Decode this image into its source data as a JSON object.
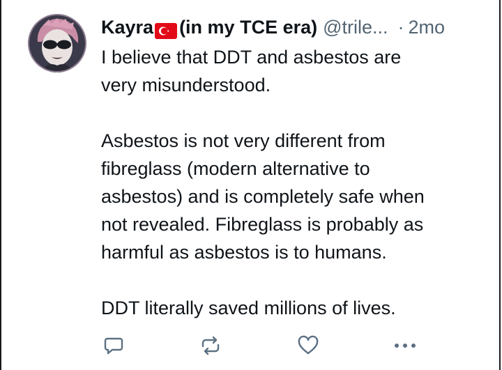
{
  "tweet": {
    "display_name": "Kayra",
    "name_suffix": "(in my TCE era)",
    "handle": "@trile...",
    "separator": "·",
    "time": "2mo",
    "paragraphs": [
      [
        "I believe that DDT and asbestos are",
        "very misunderstood."
      ],
      [
        "Asbestos is not very different from",
        "fibreglass (modern alternative to",
        "asbestos) and is completely safe when",
        "not revealed. Fibreglass is probably as",
        "harmful as asbestos is to humans."
      ],
      [
        "DDT literally saved millions of lives."
      ]
    ]
  },
  "icons": {
    "flag": "turkey-flag-icon",
    "reply": "reply-icon",
    "retweet": "retweet-icon",
    "like": "heart-icon",
    "more": "more-options-icon"
  },
  "colors": {
    "text": "#0f1419",
    "secondary": "#536471",
    "icon": "#5b7083",
    "flag_red": "#e30a17"
  }
}
